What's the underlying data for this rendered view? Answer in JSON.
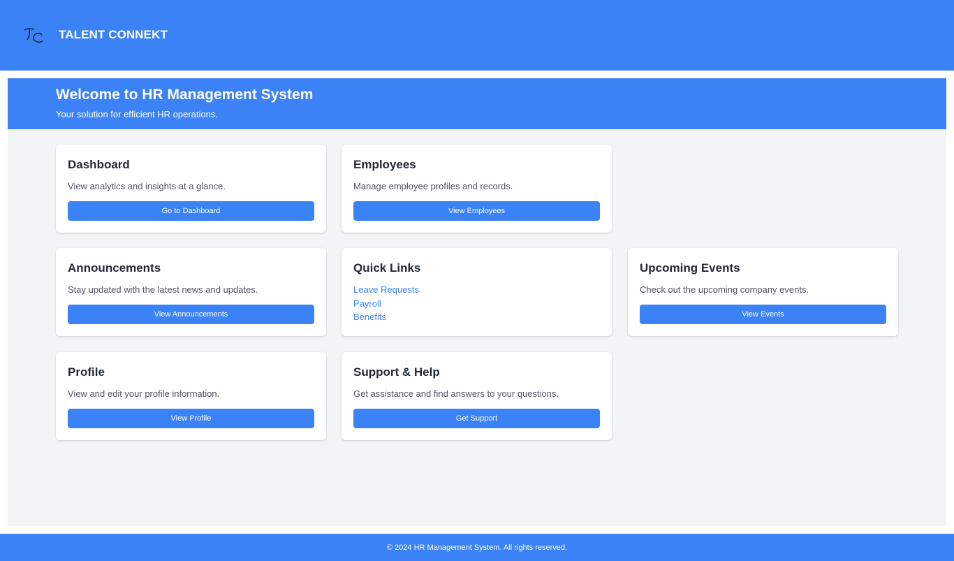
{
  "header": {
    "brand": "TALENT CONNEKT",
    "logo_icon": "tc-monogram-logo"
  },
  "hero": {
    "title": "Welcome to HR Management System",
    "subtitle": "Your solution for efficient HR operations."
  },
  "cards": {
    "dashboard": {
      "title": "Dashboard",
      "desc": "View analytics and insights at a glance.",
      "button": "Go to Dashboard"
    },
    "employees": {
      "title": "Employees",
      "desc": "Manage employee profiles and records.",
      "button": "View Employees"
    },
    "announcements": {
      "title": "Announcements",
      "desc": "Stay updated with the latest news and updates.",
      "button": "View Announcements"
    },
    "quick_links": {
      "title": "Quick Links",
      "links": [
        "Leave Requests",
        "Payroll",
        "Benefits"
      ]
    },
    "events": {
      "title": "Upcoming Events",
      "desc": "Check out the upcoming company events.",
      "button": "View Events"
    },
    "profile": {
      "title": "Profile",
      "desc": "View and edit your profile information.",
      "button": "View Profile"
    },
    "support": {
      "title": "Support & Help",
      "desc": "Get assistance and find answers to your questions.",
      "button": "Get Support"
    }
  },
  "footer": {
    "text": "© 2024 HR Management System. All rights reserved."
  },
  "colors": {
    "primary": "#3b82f6",
    "background": "#f3f4f6",
    "card": "#ffffff",
    "heading": "#1f2937",
    "body_text": "#4b5563"
  }
}
